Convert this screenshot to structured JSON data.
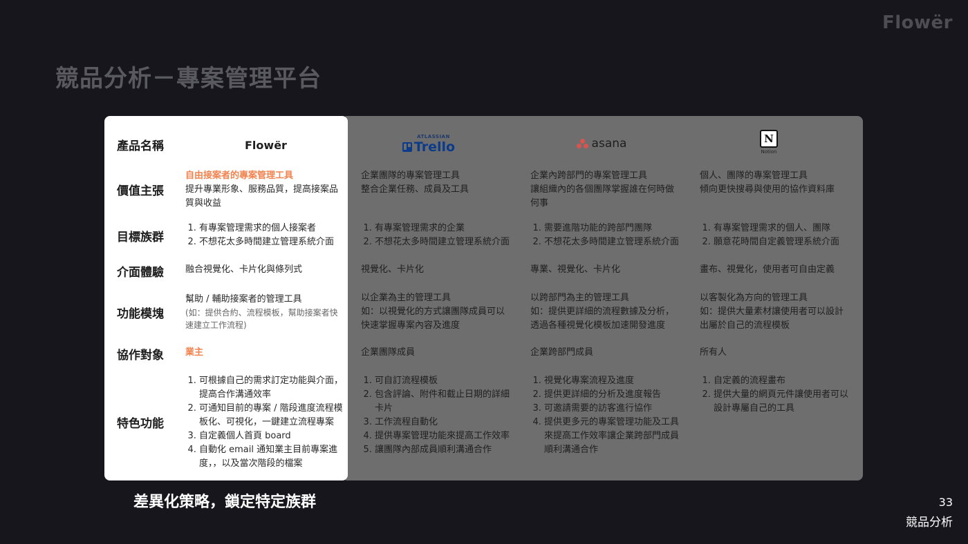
{
  "brand": "Flowër",
  "title": "競品分析－專案管理平台",
  "products": {
    "flower": "Flowër",
    "trello_super": "ATLASSIAN",
    "trello": "Trello",
    "asana": "asana",
    "notion": "Notion",
    "notion_mark": "N"
  },
  "row_labels": {
    "name": "產品名稱",
    "value": "價值主張",
    "target": "目標族群",
    "ui": "介面體驗",
    "module": "功能模塊",
    "collab": "協作對象",
    "feature": "特色功能"
  },
  "flower": {
    "value_accent": "自由接案者的專案管理工具",
    "value_text": "提升專業形象、服務品質，提高接案品質與收益",
    "target": [
      "有專案管理需求的個人接案者",
      "不想花太多時間建立管理系統介面"
    ],
    "ui": "融合視覺化、卡片化與條列式",
    "module_text": "幫助 / 輔助接案者的管理工具",
    "module_note": "(如：提供合約、流程模板，幫助接案者快速建立工作流程)",
    "collab": "業主",
    "feature": [
      "可根據自己的需求訂定功能與介面，提高合作溝通效率",
      "可通知目前的專案 / 階段進度流程模板化、可視化，一鍵建立流程專案",
      "自定義個人首頁 board",
      "自動化 email 通知業主目前專案進度，，以及當次階段的檔案"
    ]
  },
  "trello": {
    "value": "企業團隊的專案管理工具\n整合企業任務、成員及工具",
    "target": [
      "有專案管理需求的企業",
      "不想花太多時間建立管理系統介面"
    ],
    "ui": "視覺化、卡片化",
    "module": "以企業為主的管理工具\n如：以視覺化的方式讓團隊成員可以快速掌握專案內容及進度",
    "collab": "企業團隊成員",
    "feature": [
      "可自訂流程模板",
      "包含評論、附件和截止日期的詳細卡片",
      "工作流程自動化",
      "提供專案管理功能來提高工作效率",
      "讓團隊內部成員順利溝通合作"
    ]
  },
  "asana": {
    "value": "企業內跨部門的專案管理工具\n讓組織內的各個團隊掌握誰在何時做何事",
    "target": [
      "需要進階功能的跨部門團隊",
      "不想花太多時間建立管理系統介面"
    ],
    "ui": "專業、視覺化、卡片化",
    "module": "以跨部門為主的管理工具\n如：提供更詳細的流程數據及分析，透過各種視覺化模板加速開發進度",
    "collab": "企業跨部門成員",
    "feature": [
      "視覺化專案流程及進度",
      "提供更詳細的分析及進度報告",
      "可邀請需要的訪客進行協作",
      "提供更多元的專案管理功能及工具來提高工作效率讓企業跨部門成員順利溝通合作"
    ]
  },
  "notion": {
    "value": "個人、團隊的專案管理工具\n傾向更快搜尋與使用的協作資料庫",
    "target": [
      "有專案管理需求的個人、團隊",
      "願意花時間自定義管理系統介面"
    ],
    "ui": "畫布、視覺化，使用者可自由定義",
    "module": "以客製化為方向的管理工具\n如：提供大量素材讓使用者可以設計出屬於自己的流程模板",
    "collab": "所有人",
    "feature": [
      "自定義的流程畫布",
      "提供大量的網頁元件讓使用者可以設計專屬自己的工具"
    ]
  },
  "footer": {
    "tagline": "差異化策略，鎖定特定族群",
    "page_number": "33",
    "section": "競品分析"
  },
  "colors": {
    "accent": "#f0834f",
    "background": "#16161c",
    "trello_blue": "#0052cc",
    "asana_pink": "#f06a6a"
  }
}
